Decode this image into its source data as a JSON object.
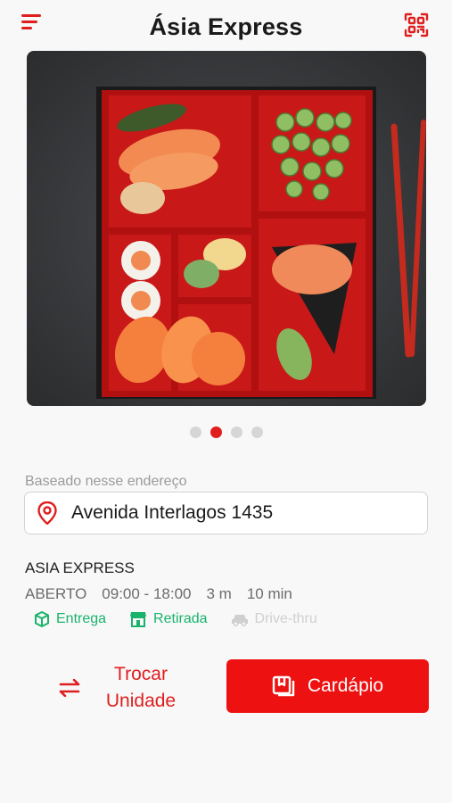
{
  "header": {
    "title": "Ásia Express"
  },
  "carousel": {
    "slides": 4,
    "active_index": 1
  },
  "address": {
    "label": "Baseado nesse endereço",
    "value": "Avenida Interlagos 1435"
  },
  "store": {
    "name": "ASIA EXPRESS",
    "status": "ABERTO",
    "hours": "09:00 - 18:00",
    "distance": "3 m",
    "time": "10 min"
  },
  "modes": [
    {
      "label": "Entrega",
      "enabled": true
    },
    {
      "label": "Retirada",
      "enabled": true
    },
    {
      "label": "Drive-thru",
      "enabled": false
    }
  ],
  "actions": {
    "swap_line1": "Trocar",
    "swap_line2": "Unidade",
    "menu": "Cardápio"
  },
  "colors": {
    "accent": "#e01e1e",
    "green": "#19b36b",
    "disabled": "#cfcfcf"
  }
}
